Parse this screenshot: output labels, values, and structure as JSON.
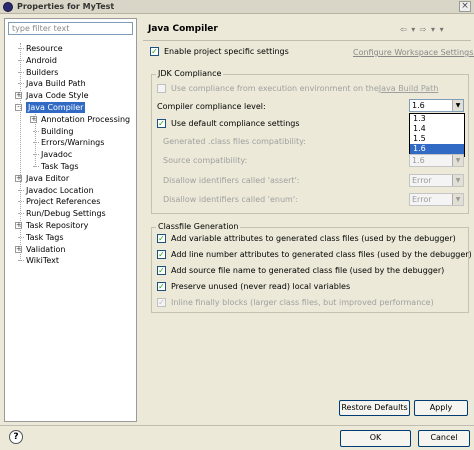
{
  "window": {
    "title": "Properties for MyTest"
  },
  "filter": {
    "placeholder": "type filter text"
  },
  "tree": [
    {
      "label": "Resource",
      "depth": 0
    },
    {
      "label": "Android",
      "depth": 0
    },
    {
      "label": "Builders",
      "depth": 0
    },
    {
      "label": "Java Build Path",
      "depth": 0
    },
    {
      "label": "Java Code Style",
      "depth": 0,
      "expander": "+"
    },
    {
      "label": "Java Compiler",
      "depth": 0,
      "expander": "−",
      "selected": true
    },
    {
      "label": "Annotation Processing",
      "depth": 1,
      "expander": "+"
    },
    {
      "label": "Building",
      "depth": 1
    },
    {
      "label": "Errors/Warnings",
      "depth": 1
    },
    {
      "label": "Javadoc",
      "depth": 1
    },
    {
      "label": "Task Tags",
      "depth": 1
    },
    {
      "label": "Java Editor",
      "depth": 0,
      "expander": "+"
    },
    {
      "label": "Javadoc Location",
      "depth": 0
    },
    {
      "label": "Project References",
      "depth": 0
    },
    {
      "label": "Run/Debug Settings",
      "depth": 0
    },
    {
      "label": "Task Repository",
      "depth": 0,
      "expander": "+"
    },
    {
      "label": "Task Tags",
      "depth": 0
    },
    {
      "label": "Validation",
      "depth": 0,
      "expander": "+"
    },
    {
      "label": "WikiText",
      "depth": 0
    }
  ],
  "page": {
    "title": "Java Compiler",
    "nav_arrows": "⇦ ▾ ⇨ ▾ ▾",
    "enable_specific": "Enable project specific settings",
    "configure_link": "Configure Workspace Settings...",
    "jdk_group": "JDK Compliance",
    "use_compliance_prefix": "Use compliance from execution environment on the ",
    "use_compliance_link": "Java Build Path",
    "compliance_level_label": "Compiler compliance level:",
    "compliance_level_value": "1.6",
    "compliance_options": [
      "1.3",
      "1.4",
      "1.5",
      "1.6"
    ],
    "use_default": "Use default compliance settings",
    "generated_class_label": "Generated .class files compatibility:",
    "source_compat_label": "Source compatibility:",
    "source_compat_value": "1.6",
    "disallow_assert_label": "Disallow identifiers called 'assert':",
    "disallow_assert_value": "Error",
    "disallow_enum_label": "Disallow identifiers called 'enum':",
    "disallow_enum_value": "Error",
    "classfile_group": "Classfile Generation",
    "cb_variable": "Add variable attributes to generated class files (used by the debugger)",
    "cb_line": "Add line number attributes to generated class files (used by the debugger)",
    "cb_source": "Add source file name to generated class file (used by the debugger)",
    "cb_preserve": "Preserve unused (never read) local variables",
    "cb_inline": "Inline finally blocks (larger class files, but improved performance)"
  },
  "buttons": {
    "restore": "Restore Defaults",
    "apply": "Apply",
    "ok": "OK",
    "cancel": "Cancel",
    "help": "?"
  },
  "check_glyph": "✓"
}
